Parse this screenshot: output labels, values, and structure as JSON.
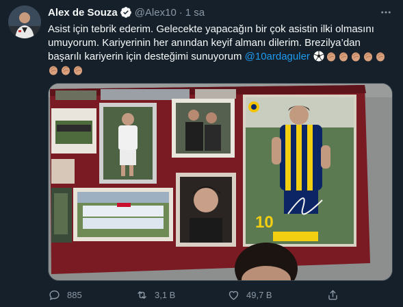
{
  "author": {
    "display_name": "Alex de Souza",
    "handle": "@Alex10",
    "separator": "·",
    "time_ago": "1 sa",
    "verified": true
  },
  "tweet": {
    "line1": "Asist için tebrik ederim. Gelecekte yapacağın bir çok asistin ilki olmasını",
    "line2": "umuyorum.  Kariyerinin  her anından keyif almanı dilerim. Brezilya’dan",
    "line3_text": "başarılı kariyerin için desteğimi sunuyorum ",
    "mention": "@10ardaguler",
    "emojis": [
      "soccer-ball",
      "clap",
      "clap",
      "clap",
      "clap",
      "clap",
      "clap",
      "clap",
      "clap"
    ]
  },
  "media": {
    "description_icon": "photo"
  },
  "actions": {
    "reply_count": "885",
    "retweet_count": "3,1 B",
    "like_count": "49,7 B"
  },
  "colors": {
    "background": "#15202b",
    "text": "#f7f9f9",
    "secondary": "#8b98a5",
    "accent": "#1d9bf0"
  }
}
